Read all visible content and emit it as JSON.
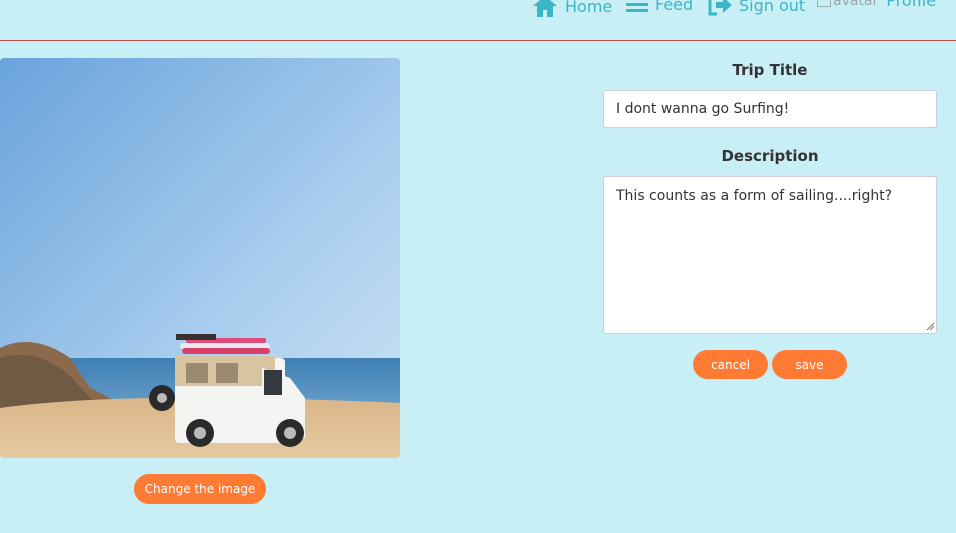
{
  "nav": {
    "home": "Home",
    "feed": "Feed",
    "signout": "Sign out",
    "avatar_alt": "avatar",
    "profile": "Profile"
  },
  "image": {
    "alt": "white jeep with surfboards on a cliff by the sea",
    "change_label": "Change the image"
  },
  "form": {
    "title_label": "Trip Title",
    "title_value": "I dont wanna go Surfing!",
    "description_label": "Description",
    "description_value": "This counts as a form of sailing....right?",
    "cancel_label": "cancel",
    "save_label": "save"
  },
  "colors": {
    "background": "#c8eef6",
    "accent": "#3bb6c5",
    "button": "#ff7a33",
    "divider": "#c0504d"
  },
  "icons": {
    "home": "home-icon",
    "feed": "menu-icon",
    "signout": "sign-out-icon"
  }
}
